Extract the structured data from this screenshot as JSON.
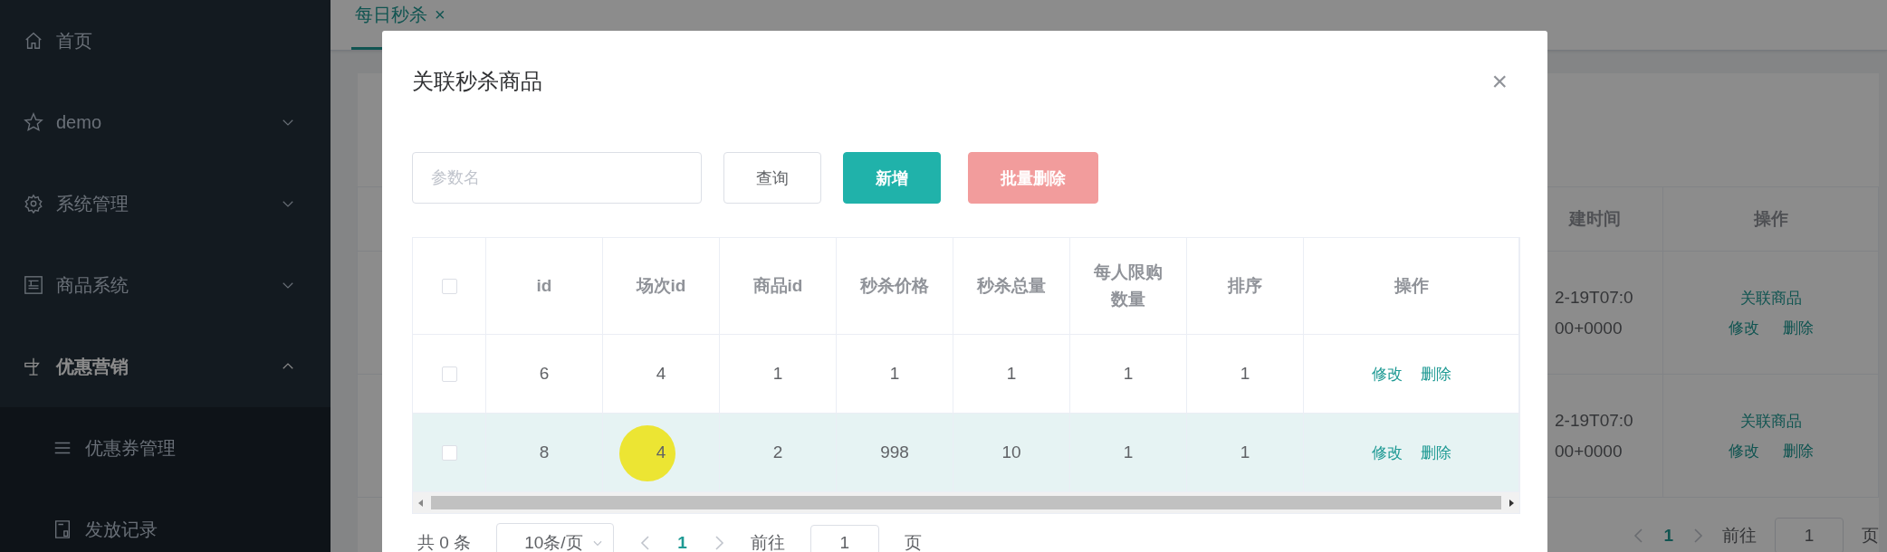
{
  "sidebar": {
    "items": [
      {
        "kind": "link",
        "label": "首页",
        "selected": false
      },
      {
        "kind": "group",
        "label": "demo",
        "expanded": false,
        "selected": false
      },
      {
        "kind": "group",
        "label": "系统管理",
        "expanded": false,
        "selected": false
      },
      {
        "kind": "group",
        "label": "商品系统",
        "expanded": false,
        "selected": false
      },
      {
        "kind": "group",
        "label": "优惠营销",
        "expanded": true,
        "selected": true,
        "children": [
          {
            "label": "优惠券管理",
            "selected": false
          },
          {
            "label": "发放记录",
            "selected": false
          }
        ]
      }
    ]
  },
  "tabs": [
    {
      "label": "每日秒杀",
      "close": "×",
      "selected": true
    }
  ],
  "background_table": {
    "columns": [
      "建时间",
      "操作"
    ],
    "rows": [
      {
        "created": [
          "2-19T07:0",
          "00+0000"
        ],
        "actions": [
          "关联商品",
          "修改",
          "删除"
        ]
      },
      {
        "created": [
          "2-19T07:0",
          "00+0000"
        ],
        "actions": [
          "关联商品",
          "修改",
          "删除"
        ]
      }
    ]
  },
  "background_pagination": {
    "pages": [
      {
        "label": "1",
        "selected": true
      }
    ],
    "jump_label": "前往",
    "jump_value": "1",
    "unit": "页"
  },
  "dialog": {
    "title": "关联秒杀商品",
    "close": "×",
    "search": {
      "placeholder": "参数名"
    },
    "buttons": [
      {
        "label": "查询",
        "kind": "default"
      },
      {
        "label": "新增",
        "kind": "primary"
      },
      {
        "label": "批量删除",
        "kind": "danger",
        "disabled": true
      }
    ],
    "table": {
      "all_checked": false,
      "columns": [
        "id",
        "场次id",
        "商品id",
        "秒杀价格",
        "秒杀总量",
        "每人限购数量",
        "排序",
        "操作"
      ],
      "rows": [
        {
          "checked": false,
          "highlighted": false,
          "cells": [
            "6",
            "4",
            "1",
            "1",
            "1",
            "1",
            "1"
          ],
          "actions": [
            "修改",
            "删除"
          ]
        },
        {
          "checked": false,
          "highlighted": true,
          "cells": [
            "8",
            "4",
            "2",
            "998",
            "10",
            "1",
            "1"
          ],
          "actions": [
            "修改",
            "删除"
          ]
        }
      ]
    },
    "pagination": {
      "total": "共 0 条",
      "page_size": "10条/页",
      "pages": [
        {
          "label": "1",
          "selected": true
        }
      ],
      "jump_label": "前往",
      "jump_value": "1",
      "unit": "页"
    }
  }
}
